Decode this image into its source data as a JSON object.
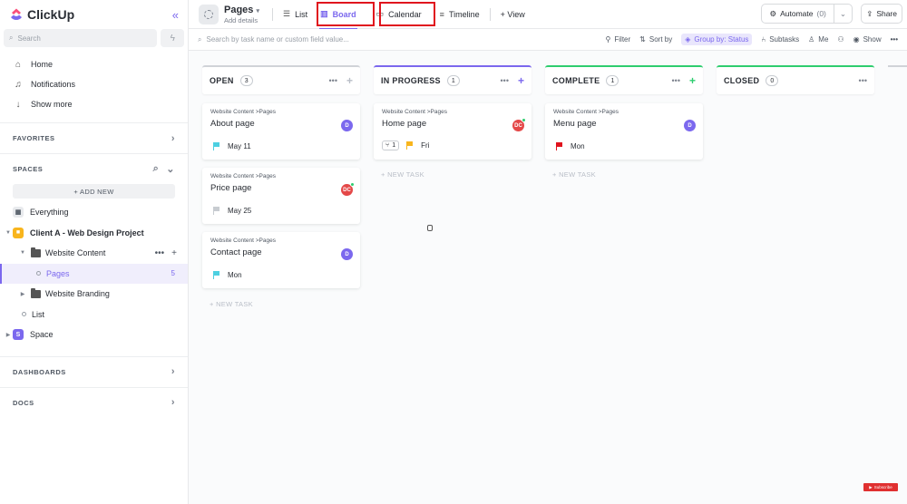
{
  "app": {
    "name": "ClickUp"
  },
  "sidebar": {
    "search_placeholder": "Search",
    "nav": [
      {
        "label": "Home",
        "icon": "home-icon"
      },
      {
        "label": "Notifications",
        "icon": "bell-icon"
      },
      {
        "label": "Show more",
        "icon": "arrow-down-icon"
      }
    ],
    "favorites_label": "FAVORITES",
    "spaces_label": "SPACES",
    "add_new_label": "+ ADD NEW",
    "everything_label": "Everything",
    "space1": {
      "label": "Client A - Web Design Project",
      "color": "#f8b51d"
    },
    "folder1": {
      "label": "Website Content"
    },
    "list_pages": {
      "label": "Pages",
      "count": "5"
    },
    "folder2": {
      "label": "Website Branding"
    },
    "list_list": {
      "label": "List"
    },
    "space2": {
      "label": "Space",
      "letter": "S",
      "color": "#7b68ee"
    },
    "dashboards_label": "DASHBOARDS",
    "docs_label": "DOCS"
  },
  "topbar": {
    "title": "Pages",
    "subtitle": "Add details",
    "tabs": [
      {
        "label": "List"
      },
      {
        "label": "Board"
      },
      {
        "label": "Calendar"
      },
      {
        "label": "Timeline"
      }
    ],
    "add_view_label": "+ View",
    "automate_label": "Automate",
    "automate_count": "(0)",
    "share_label": "Share"
  },
  "filterbar": {
    "search_placeholder": "Search by task name or custom field value...",
    "filter_label": "Filter",
    "sort_label": "Sort by",
    "group_label": "Group by: Status",
    "subtasks_label": "Subtasks",
    "me_label": "Me",
    "show_label": "Show"
  },
  "board": {
    "new_task_label": "+ NEW TASK",
    "columns": [
      {
        "title": "OPEN",
        "count": "3",
        "color": "#d0d3d8",
        "cards": [
          {
            "crumb": "Website Content  >Pages",
            "title": "About page",
            "date": "May 11",
            "flag_color": "#4dd0e1",
            "avatar": "D",
            "avatar_color": "#7b68ee"
          },
          {
            "crumb": "Website Content  >Pages",
            "title": "Price page",
            "date": "May 25",
            "flag_color": "#c8ccd1",
            "avatar": "DC",
            "avatar_color": "#e44848"
          },
          {
            "crumb": "Website Content  >Pages",
            "title": "Contact page",
            "date": "Mon",
            "flag_color": "#4dd0e1",
            "avatar": "D",
            "avatar_color": "#7b68ee"
          }
        ]
      },
      {
        "title": "IN PROGRESS",
        "count": "1",
        "color": "#7b68ee",
        "cards": [
          {
            "crumb": "Website Content  >Pages",
            "title": "Home page",
            "date": "Fri",
            "subtasks": "1",
            "flag_color": "#f8b51d",
            "avatar": "DC",
            "avatar_color": "#e44848"
          }
        ]
      },
      {
        "title": "COMPLETE",
        "count": "1",
        "color": "#2ecd6f",
        "cards": [
          {
            "crumb": "Website Content  >Pages",
            "title": "Menu page",
            "date": "Mon",
            "flag_color": "#e0141e",
            "avatar": "D",
            "avatar_color": "#7b68ee"
          }
        ]
      },
      {
        "title": "CLOSED",
        "count": "0",
        "color": "#2ecd6f",
        "cards": []
      }
    ]
  },
  "badge": {
    "label": "Subscribe"
  }
}
